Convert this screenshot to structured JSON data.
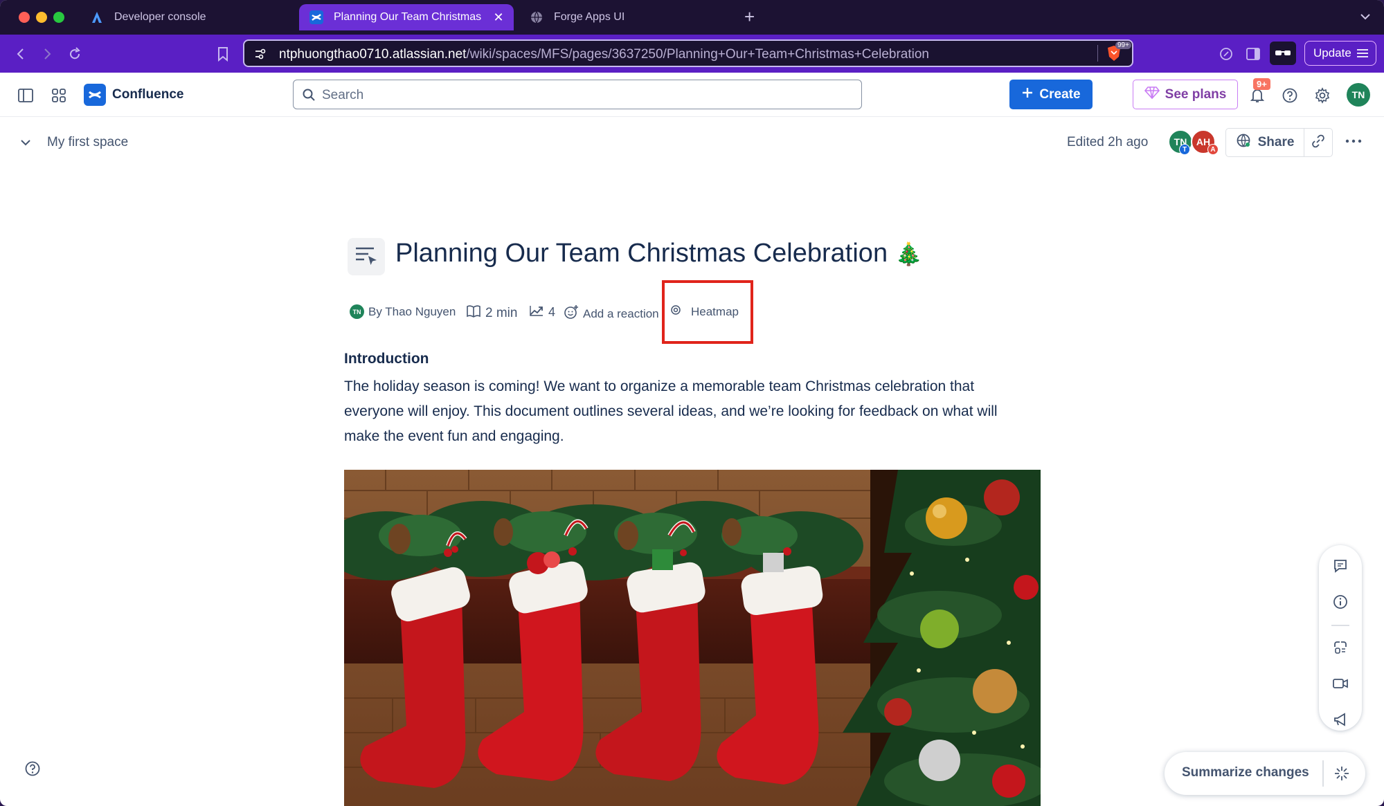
{
  "browser": {
    "tabs": [
      {
        "title": "Developer console",
        "favicon": "atlassian-icon",
        "active": false
      },
      {
        "title": "Planning Our Team Christmas",
        "favicon": "confluence-icon",
        "active": true
      },
      {
        "title": "Forge Apps UI",
        "favicon": "globe-icon",
        "active": false
      }
    ],
    "url_host": "ntphuongthao0710.atlassian.net",
    "url_path": "/wiki/spaces/MFS/pages/3637250/Planning+Our+Team+Christmas+Celebration",
    "shield_badge": "99+",
    "update_label": "Update"
  },
  "header": {
    "product": "Confluence",
    "search_placeholder": "Search",
    "create_label": "Create",
    "plans_label": "See plans",
    "notification_count": "9+",
    "user_initials": "TN"
  },
  "spacebar": {
    "space_name": "My first space",
    "edited": "Edited 2h ago",
    "collaborators": [
      {
        "initials": "TN",
        "sub": "T",
        "color": "#1f845a"
      },
      {
        "initials": "AH",
        "sub": "A",
        "color": "#c9372c"
      }
    ],
    "share_label": "Share"
  },
  "page": {
    "title": "Planning Our Team Christmas Celebration",
    "title_emoji": "🎄",
    "author_initials": "TN",
    "author": "By Thao Nguyen",
    "read_time": "2 min",
    "views": "4",
    "reaction_label": "Add a reaction",
    "heatmap_label": "Heatmap",
    "intro_heading": "Introduction",
    "intro_text": "The holiday season is coming! We want to organize a memorable team Christmas celebration that everyone will enjoy. This document outlines several ideas, and we’re looking for feedback on what will make the event fun and engaging."
  },
  "floating": {
    "summarize_label": "Summarize changes"
  },
  "colors": {
    "brand": "#1868db",
    "browser_accent": "#6b2fd6",
    "highlight": "#e0241b"
  }
}
